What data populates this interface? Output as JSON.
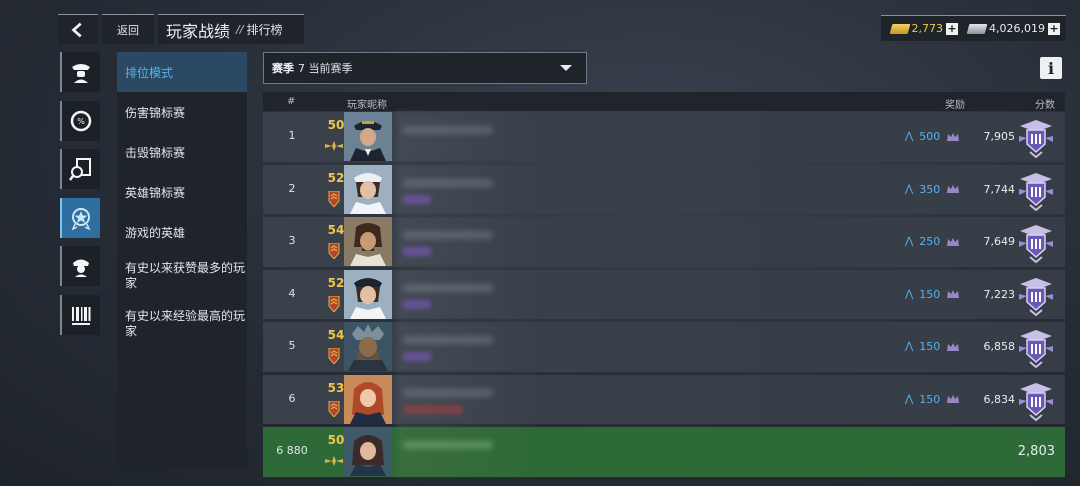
{
  "header": {
    "back_label": "返回",
    "title": "玩家战绩",
    "separator": "//",
    "subtitle": "排行榜"
  },
  "currency": {
    "gold": "2,773",
    "silver": "4,026,019",
    "gold_color": "#f0c64a"
  },
  "rail": {
    "items": [
      "officer-icon",
      "percent-gauge-icon",
      "magnifier-document-icon",
      "star-badge-icon",
      "hero-helmet-icon",
      "barcode-icon"
    ],
    "active_index": 3
  },
  "categories": [
    {
      "label": "排位模式",
      "active": true
    },
    {
      "label": "伤害锦标赛"
    },
    {
      "label": "击毁锦标赛"
    },
    {
      "label": "英雄锦标赛"
    },
    {
      "label": "游戏的英雄"
    },
    {
      "label": "有史以来获赞最多的玩家"
    },
    {
      "label": "有史以来经验最高的玩家"
    }
  ],
  "season": {
    "label": "赛季",
    "value": "7 当前赛季"
  },
  "table": {
    "headers": {
      "rank": "#",
      "nickname": "玩家昵称",
      "reward": "奖励",
      "score": "分数"
    },
    "rows": [
      {
        "rank": "1",
        "level": "50",
        "reward": "500",
        "score": "7,905"
      },
      {
        "rank": "2",
        "level": "52",
        "reward": "350",
        "score": "7,744"
      },
      {
        "rank": "3",
        "level": "54",
        "reward": "250",
        "score": "7,649"
      },
      {
        "rank": "4",
        "level": "52",
        "reward": "150",
        "score": "7,223"
      },
      {
        "rank": "5",
        "level": "54",
        "reward": "150",
        "score": "6,858"
      },
      {
        "rank": "6",
        "level": "53",
        "reward": "150",
        "score": "6,834"
      }
    ],
    "me": {
      "rank": "6 880",
      "level": "50",
      "score": "2,803"
    }
  },
  "colors": {
    "accent": "#4fb4f0",
    "me_row": "#2e6a37",
    "reward": "#5ab2ee"
  }
}
